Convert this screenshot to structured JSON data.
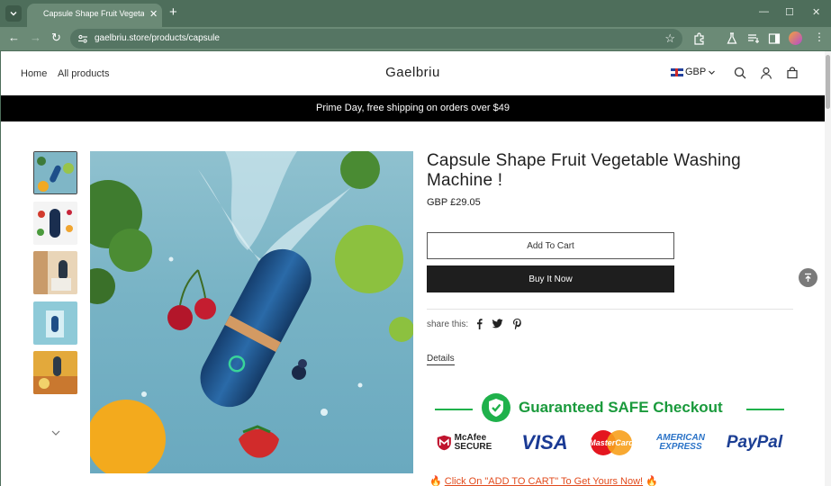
{
  "browser": {
    "tab_title": "Capsule Shape Fruit Vegetable Washing Machine",
    "url": "gaelbriu.store/products/capsule"
  },
  "header": {
    "nav": [
      "Home",
      "All products"
    ],
    "logo": "Gaelbriu",
    "currency": "GBP"
  },
  "announcement": "Prime Day, free shipping on orders over $49",
  "product": {
    "title": "Capsule Shape Fruit Vegetable Washing Machine !",
    "price": "GBP £29.05",
    "add_to_cart": "Add To Cart",
    "buy_now": "Buy It Now",
    "share_label": "share this:",
    "details_tab": "Details"
  },
  "trust_badge": {
    "title": "Guaranteed SAFE Checkout",
    "logos": [
      "McAfee SECURE",
      "VISA",
      "MasterCard",
      "AMERICAN EXPRESS",
      "PayPal"
    ]
  },
  "cta": "Click On \"ADD TO CART\" To Get Yours Now!",
  "colors": {
    "browser_frame": "#4e6e5b",
    "announcement_bg": "#000000",
    "buy_button": "#1e1e1e",
    "badge_green": "#1a9a3c",
    "cta_orange": "#e24b1d"
  }
}
